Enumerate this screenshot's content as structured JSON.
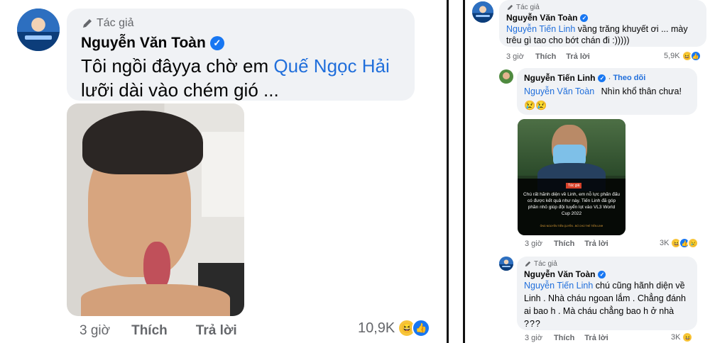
{
  "left": {
    "author_tag": "Tác giả",
    "author_name": "Nguyễn Văn Toàn",
    "comment_text_before": "Tôi ngồi đâyya chờ em",
    "comment_mention": "Quế Ngọc Hải",
    "comment_text_after": "lưỡi dài vào chém gió ...",
    "time": "3 giờ",
    "like_label": "Thích",
    "reply_label": "Trả lời",
    "reaction_count": "10,9K"
  },
  "right": {
    "c1": {
      "author_tag": "Tác giả",
      "author_name": "Nguyễn Văn Toàn",
      "mention": "Nguyễn Tiến Linh",
      "text": "vầng trăng khuyết ơi ... mày trêu gì tao cho bớt chán đi :)))))",
      "time": "3 giờ",
      "like_label": "Thích",
      "reply_label": "Trả lời",
      "reaction_count": "5,9K"
    },
    "c2": {
      "author_name": "Nguyễn Tiến Linh",
      "follow_label": "Theo dõi",
      "mention": "Nguyễn Văn Toàn",
      "text": "Nhìn khổ thân chưa!",
      "emoji": "😢😢",
      "image_tag": "Tác giả",
      "image_quote": "Chú rất hãnh diện về Linh, em nỗ lực phấn đấu có được kết quả như này. Tiến Linh đã góp phần nhỏ giúp đội tuyển lọt vào VL3 World Cup 2022",
      "image_caption": "ÔNG NGUYỄN TIẾN QUYỀN - BỐ CHÚ THỂ TIẾN LINH",
      "time": "3 giờ",
      "like_label": "Thích",
      "reply_label": "Trả lời",
      "reaction_count": "3K"
    },
    "c3": {
      "author_tag": "Tác giả",
      "author_name": "Nguyễn Văn Toàn",
      "mention": "Nguyễn Tiến Linh",
      "text_a": "chú cũng hãnh diện về Linh . Nhà cháu ngoan lắm . Chẳng đánh ai bao h . Mà cháu chẳng bao h ở nhà",
      "boxes": "???",
      "time": "3 giờ",
      "like_label": "Thích",
      "reply_label": "Trả lời",
      "reaction_count": "3K"
    }
  },
  "colors": {
    "bubble": "#f0f2f5",
    "mention": "#216fdb",
    "verified": "#1877f2",
    "meta": "#65676b"
  },
  "icons": [
    "pen-icon",
    "verified-icon",
    "haha-icon",
    "like-icon",
    "sad-icon"
  ]
}
